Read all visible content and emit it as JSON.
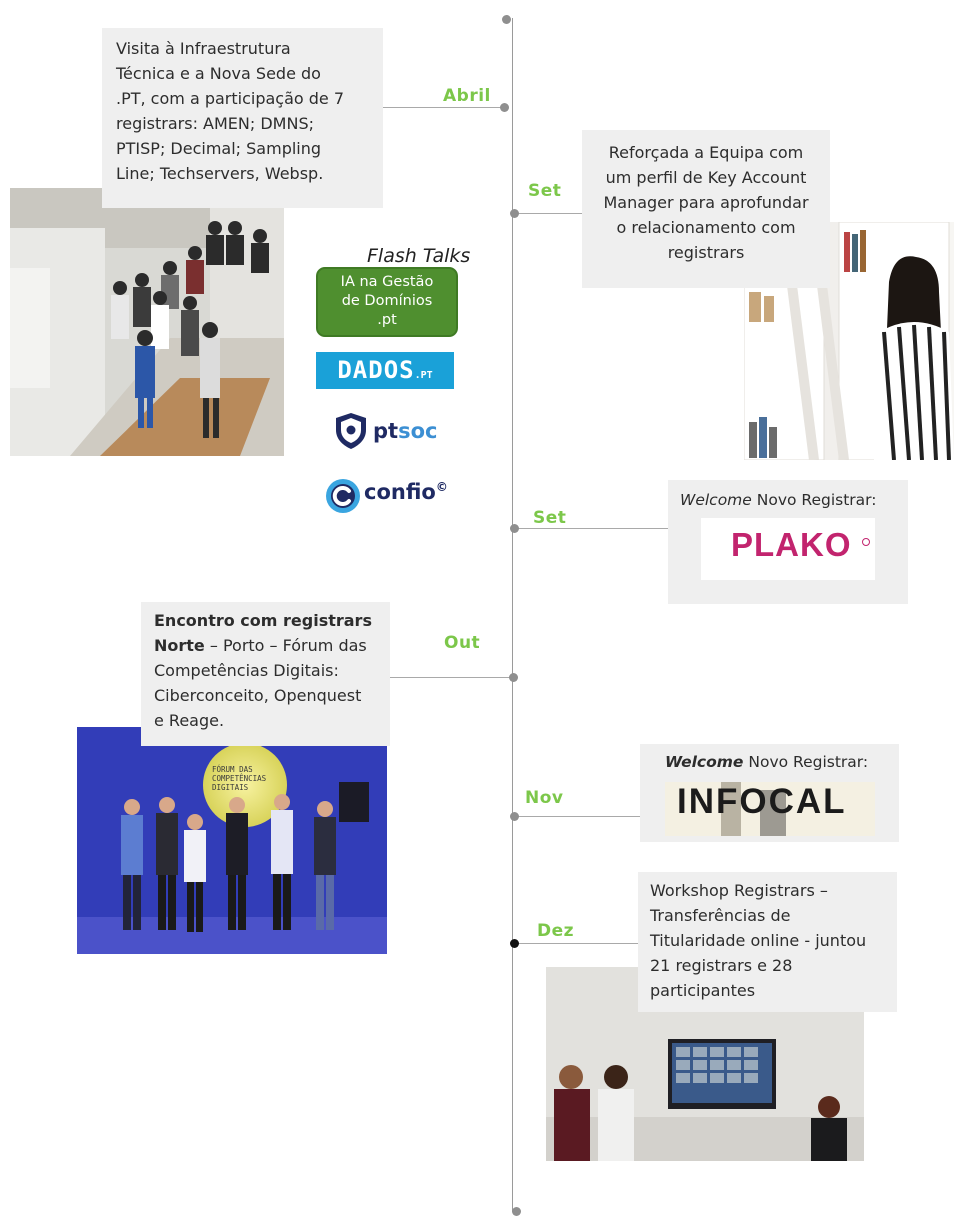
{
  "timeline": {
    "months": [
      "Abril",
      "Set",
      "Set",
      "Out",
      "Nov",
      "Dez"
    ]
  },
  "events": {
    "abril": {
      "text": "Visita à Infraestrutura Técnica e a Nova Sede do .PT, com a participação de 7 registrars: AMEN; DMNS; PTISP; Decimal; Sampling Line; Techservers, Websp.",
      "lines": [
        "Visita à Infraestrutura",
        "Técnica e a Nova Sede do",
        ".PT, com a participação de 7",
        "registrars: AMEN; DMNS;",
        "PTISP; Decimal; Sampling",
        "Line; Techservers, Websp."
      ]
    },
    "set1": {
      "lines": [
        "Reforçada a Equipa com",
        "um perfil de Key Account",
        "Manager para aprofundar",
        "o relacionamento com",
        "registrars"
      ]
    },
    "set2": {
      "italic": "Welcome",
      "rest": " Novo Registrar:",
      "logo": "PLAKO"
    },
    "out": {
      "bold1": "Encontro com registrars",
      "bold2": "Norte",
      "line2_rest": " – Porto – Fórum das",
      "line3": "Competências Digitais:",
      "line4": "Ciberconceito, Openquest",
      "line5": "e Reage."
    },
    "nov": {
      "bolditalic": "Welcome",
      "rest": " Novo Registrar:",
      "logo": "INFOCAL"
    },
    "dez": {
      "lines": [
        "Workshop Registrars –",
        "Transferências de",
        "Titularidade online - juntou",
        "21 registrars e 28",
        "participantes"
      ]
    }
  },
  "flash_talks": {
    "title": "Flash Talks",
    "ia_badge": [
      "IA na Gestão",
      "de Domínios",
      ".pt"
    ],
    "dados": "DADOS",
    "dados_suffix": ".PT",
    "ptsoc_pt": "pt",
    "ptsoc_soc": "soc",
    "confio": "confio",
    "confio_mark": "©"
  },
  "photo_sign_text": [
    "FÓRUM DAS",
    "COMPETÊNCIAS",
    "DIGITAIS"
  ],
  "colors": {
    "month_green": "#7cc74a",
    "box_gray": "#efefef",
    "ia_green": "#4f8f2f",
    "dados_blue": "#1aa1d8",
    "plako_pink": "#c2246e"
  }
}
